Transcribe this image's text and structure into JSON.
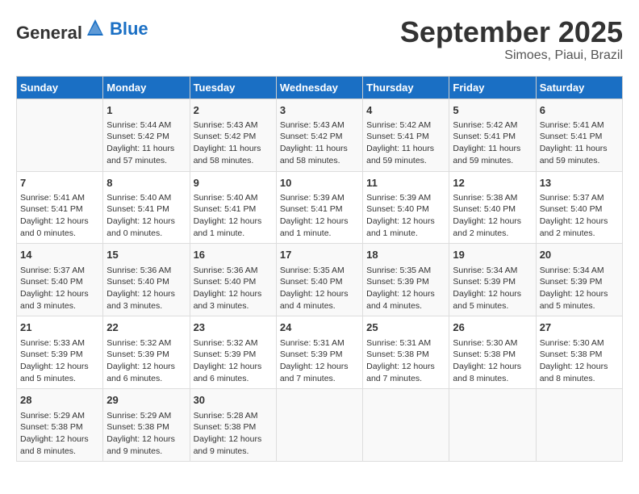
{
  "header": {
    "logo_general": "General",
    "logo_blue": "Blue",
    "title": "September 2025",
    "subtitle": "Simoes, Piaui, Brazil"
  },
  "days_of_week": [
    "Sunday",
    "Monday",
    "Tuesday",
    "Wednesday",
    "Thursday",
    "Friday",
    "Saturday"
  ],
  "weeks": [
    [
      {
        "day": "",
        "info": ""
      },
      {
        "day": "1",
        "info": "Sunrise: 5:44 AM\nSunset: 5:42 PM\nDaylight: 11 hours\nand 57 minutes."
      },
      {
        "day": "2",
        "info": "Sunrise: 5:43 AM\nSunset: 5:42 PM\nDaylight: 11 hours\nand 58 minutes."
      },
      {
        "day": "3",
        "info": "Sunrise: 5:43 AM\nSunset: 5:42 PM\nDaylight: 11 hours\nand 58 minutes."
      },
      {
        "day": "4",
        "info": "Sunrise: 5:42 AM\nSunset: 5:41 PM\nDaylight: 11 hours\nand 59 minutes."
      },
      {
        "day": "5",
        "info": "Sunrise: 5:42 AM\nSunset: 5:41 PM\nDaylight: 11 hours\nand 59 minutes."
      },
      {
        "day": "6",
        "info": "Sunrise: 5:41 AM\nSunset: 5:41 PM\nDaylight: 11 hours\nand 59 minutes."
      }
    ],
    [
      {
        "day": "7",
        "info": "Sunrise: 5:41 AM\nSunset: 5:41 PM\nDaylight: 12 hours\nand 0 minutes."
      },
      {
        "day": "8",
        "info": "Sunrise: 5:40 AM\nSunset: 5:41 PM\nDaylight: 12 hours\nand 0 minutes."
      },
      {
        "day": "9",
        "info": "Sunrise: 5:40 AM\nSunset: 5:41 PM\nDaylight: 12 hours\nand 1 minute."
      },
      {
        "day": "10",
        "info": "Sunrise: 5:39 AM\nSunset: 5:41 PM\nDaylight: 12 hours\nand 1 minute."
      },
      {
        "day": "11",
        "info": "Sunrise: 5:39 AM\nSunset: 5:40 PM\nDaylight: 12 hours\nand 1 minute."
      },
      {
        "day": "12",
        "info": "Sunrise: 5:38 AM\nSunset: 5:40 PM\nDaylight: 12 hours\nand 2 minutes."
      },
      {
        "day": "13",
        "info": "Sunrise: 5:37 AM\nSunset: 5:40 PM\nDaylight: 12 hours\nand 2 minutes."
      }
    ],
    [
      {
        "day": "14",
        "info": "Sunrise: 5:37 AM\nSunset: 5:40 PM\nDaylight: 12 hours\nand 3 minutes."
      },
      {
        "day": "15",
        "info": "Sunrise: 5:36 AM\nSunset: 5:40 PM\nDaylight: 12 hours\nand 3 minutes."
      },
      {
        "day": "16",
        "info": "Sunrise: 5:36 AM\nSunset: 5:40 PM\nDaylight: 12 hours\nand 3 minutes."
      },
      {
        "day": "17",
        "info": "Sunrise: 5:35 AM\nSunset: 5:40 PM\nDaylight: 12 hours\nand 4 minutes."
      },
      {
        "day": "18",
        "info": "Sunrise: 5:35 AM\nSunset: 5:39 PM\nDaylight: 12 hours\nand 4 minutes."
      },
      {
        "day": "19",
        "info": "Sunrise: 5:34 AM\nSunset: 5:39 PM\nDaylight: 12 hours\nand 5 minutes."
      },
      {
        "day": "20",
        "info": "Sunrise: 5:34 AM\nSunset: 5:39 PM\nDaylight: 12 hours\nand 5 minutes."
      }
    ],
    [
      {
        "day": "21",
        "info": "Sunrise: 5:33 AM\nSunset: 5:39 PM\nDaylight: 12 hours\nand 5 minutes."
      },
      {
        "day": "22",
        "info": "Sunrise: 5:32 AM\nSunset: 5:39 PM\nDaylight: 12 hours\nand 6 minutes."
      },
      {
        "day": "23",
        "info": "Sunrise: 5:32 AM\nSunset: 5:39 PM\nDaylight: 12 hours\nand 6 minutes."
      },
      {
        "day": "24",
        "info": "Sunrise: 5:31 AM\nSunset: 5:39 PM\nDaylight: 12 hours\nand 7 minutes."
      },
      {
        "day": "25",
        "info": "Sunrise: 5:31 AM\nSunset: 5:38 PM\nDaylight: 12 hours\nand 7 minutes."
      },
      {
        "day": "26",
        "info": "Sunrise: 5:30 AM\nSunset: 5:38 PM\nDaylight: 12 hours\nand 8 minutes."
      },
      {
        "day": "27",
        "info": "Sunrise: 5:30 AM\nSunset: 5:38 PM\nDaylight: 12 hours\nand 8 minutes."
      }
    ],
    [
      {
        "day": "28",
        "info": "Sunrise: 5:29 AM\nSunset: 5:38 PM\nDaylight: 12 hours\nand 8 minutes."
      },
      {
        "day": "29",
        "info": "Sunrise: 5:29 AM\nSunset: 5:38 PM\nDaylight: 12 hours\nand 9 minutes."
      },
      {
        "day": "30",
        "info": "Sunrise: 5:28 AM\nSunset: 5:38 PM\nDaylight: 12 hours\nand 9 minutes."
      },
      {
        "day": "",
        "info": ""
      },
      {
        "day": "",
        "info": ""
      },
      {
        "day": "",
        "info": ""
      },
      {
        "day": "",
        "info": ""
      }
    ]
  ]
}
